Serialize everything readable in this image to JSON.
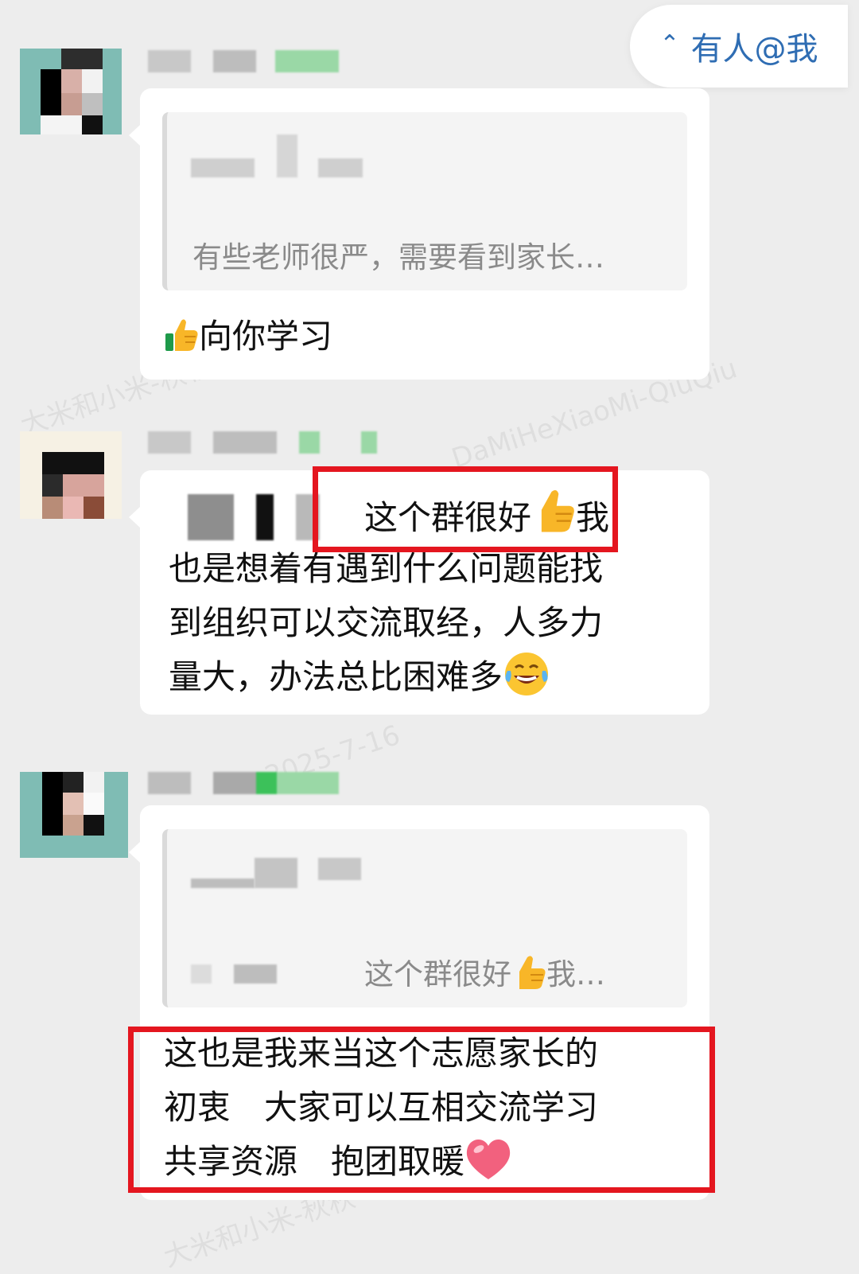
{
  "mention_banner": {
    "icon": "double-chevron-up-icon",
    "label": "有人@我"
  },
  "messages": [
    {
      "quote_preview": "有些老师很严，需要看到家长…",
      "text": "向你学习",
      "emoji": "thumbs-up-icon"
    },
    {
      "lines": [
        "这个群很好",
        "我",
        "也是想着有遇到什么问题能找",
        "到组织可以交流取经，人多力",
        "量大，办法总比困难多"
      ],
      "emoji_mid": "thumbs-up-icon",
      "emoji_end": "laughing-crying-icon",
      "highlight_color": "#e4161f"
    },
    {
      "quote_preview_a": "这个群很好",
      "quote_preview_b": "我…",
      "lines": [
        "这也是我来当这个志愿家长的",
        "初衷　大家可以互相交流学习",
        "共享资源　抱团取暖"
      ],
      "emoji_end": "heart-icon",
      "highlight_color": "#e4161f"
    }
  ],
  "watermark": {
    "text_cn": "大米和小米-秋秋",
    "text_en": "DaMiHeXiaoMi-QiuQiu",
    "date": "2025-7-16"
  }
}
